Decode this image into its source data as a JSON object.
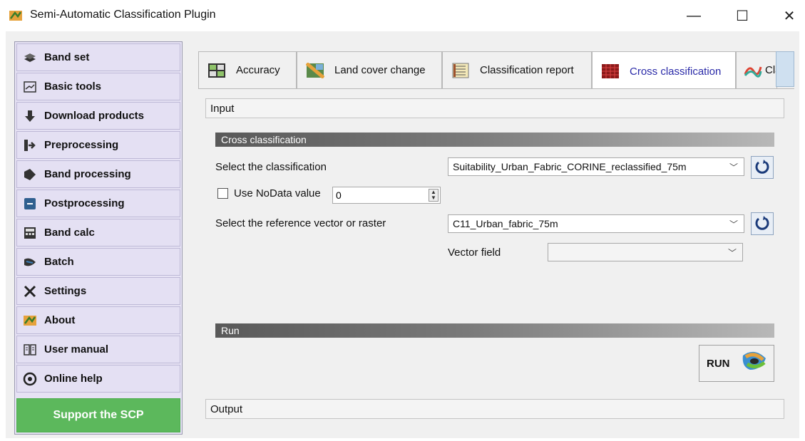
{
  "window": {
    "title": "Semi-Automatic Classification Plugin",
    "minimize_glyph": "—",
    "maximize_glyph": "☐",
    "close_glyph": "✕"
  },
  "sidebar": {
    "items": [
      {
        "label": "Band set",
        "icon": "band-set-icon"
      },
      {
        "label": "Basic tools",
        "icon": "basic-tools-icon"
      },
      {
        "label": "Download products",
        "icon": "download-icon"
      },
      {
        "label": "Preprocessing",
        "icon": "preprocessing-icon"
      },
      {
        "label": "Band processing",
        "icon": "band-processing-icon"
      },
      {
        "label": "Postprocessing",
        "icon": "postprocessing-icon"
      },
      {
        "label": "Band calc",
        "icon": "band-calc-icon"
      },
      {
        "label": "Batch",
        "icon": "batch-icon"
      },
      {
        "label": "Settings",
        "icon": "settings-icon"
      },
      {
        "label": "About",
        "icon": "about-icon"
      },
      {
        "label": "User manual",
        "icon": "user-manual-icon"
      },
      {
        "label": "Online help",
        "icon": "online-help-icon"
      }
    ],
    "support_label": "Support the SCP"
  },
  "tabs": [
    {
      "label": "Accuracy",
      "active": false
    },
    {
      "label": "Land cover change",
      "active": false
    },
    {
      "label": "Classification report",
      "active": false
    },
    {
      "label": "Cross classification",
      "active": true
    },
    {
      "label": "Clas",
      "active": false
    }
  ],
  "sections": {
    "input": "Input",
    "output": "Output"
  },
  "cross_group": {
    "header": "Cross classification",
    "select_classification_label": "Select the classification",
    "classification_value": "Suitability_Urban_Fabric_CORINE_reclassified_75m",
    "nodata_label": "Use NoData value",
    "nodata_value": "0",
    "select_reference_label": "Select the reference vector or raster",
    "reference_value": "C11_Urban_fabric_75m",
    "vector_field_label": "Vector field",
    "vector_field_value": ""
  },
  "run_group": {
    "header": "Run",
    "run_label": "RUN"
  },
  "colors": {
    "sidebar_bg": "#e4e0f3",
    "support_bg": "#5cb85c",
    "active_tab_text": "#2a2aa8"
  }
}
